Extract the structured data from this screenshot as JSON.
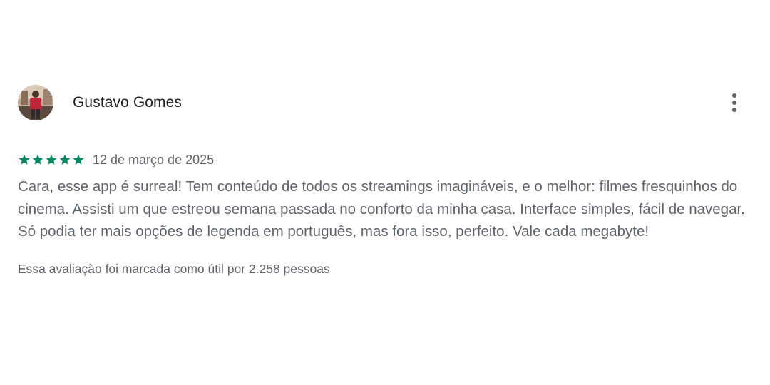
{
  "review": {
    "author": "Gustavo Gomes",
    "avatar_icon": "user-photo-avatar",
    "more_icon": "more-vertical-icon",
    "rating": 5,
    "rating_max": 5,
    "star_color": "#01875f",
    "date": "12 de março de 2025",
    "text": "Cara, esse app é surreal! Tem conteúdo de todos os streamings imagináveis, e o melhor: filmes fresquinhos do cinema. Assisti um que estreou semana passada no conforto da minha casa. Interface simples, fácil de navegar. Só podia ter mais opções de legenda em português, mas fora isso, perfeito. Vale cada megabyte!",
    "helpful": "Essa avaliação foi marcada como útil por 2.258 pessoas"
  }
}
